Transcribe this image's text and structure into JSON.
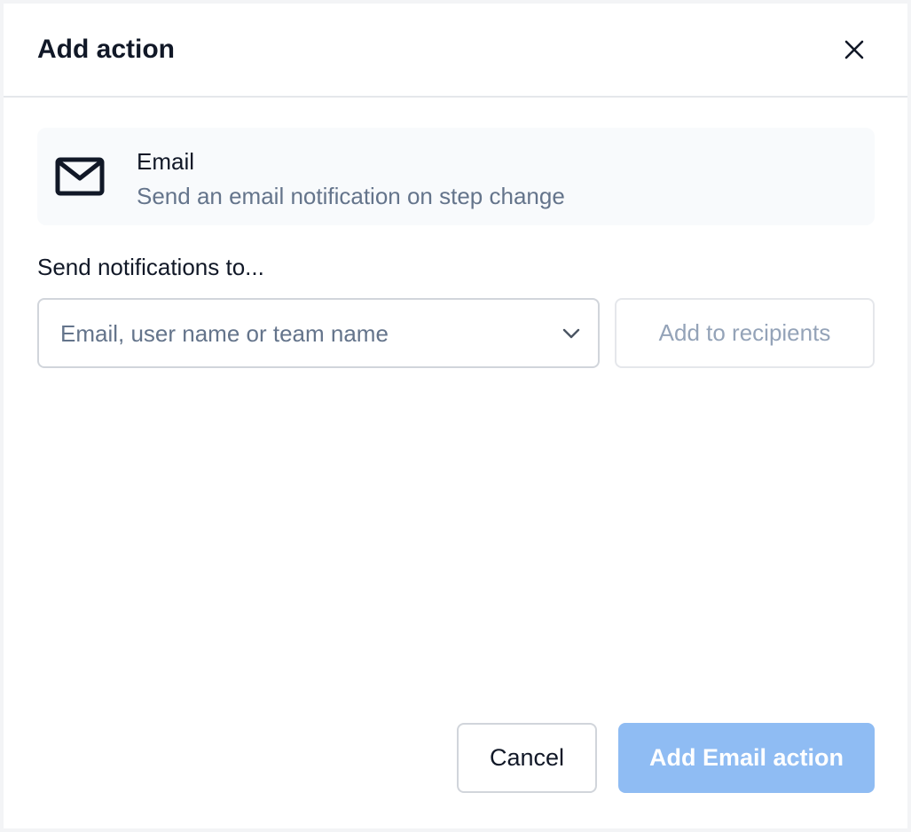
{
  "dialog": {
    "title": "Add action",
    "close_icon": "close-icon"
  },
  "action": {
    "icon": "mail-icon",
    "name": "Email",
    "description": "Send an email notification on step change"
  },
  "recipients": {
    "label": "Send notifications to...",
    "placeholder": "Email, user name or team name",
    "dropdown_icon": "chevron-down-icon",
    "add_label": "Add to recipients"
  },
  "footer": {
    "cancel_label": "Cancel",
    "submit_label": "Add Email action"
  },
  "colors": {
    "primary_disabled": "#8fbcf3",
    "muted_text": "#64748b",
    "card_background": "#f8fafc"
  }
}
